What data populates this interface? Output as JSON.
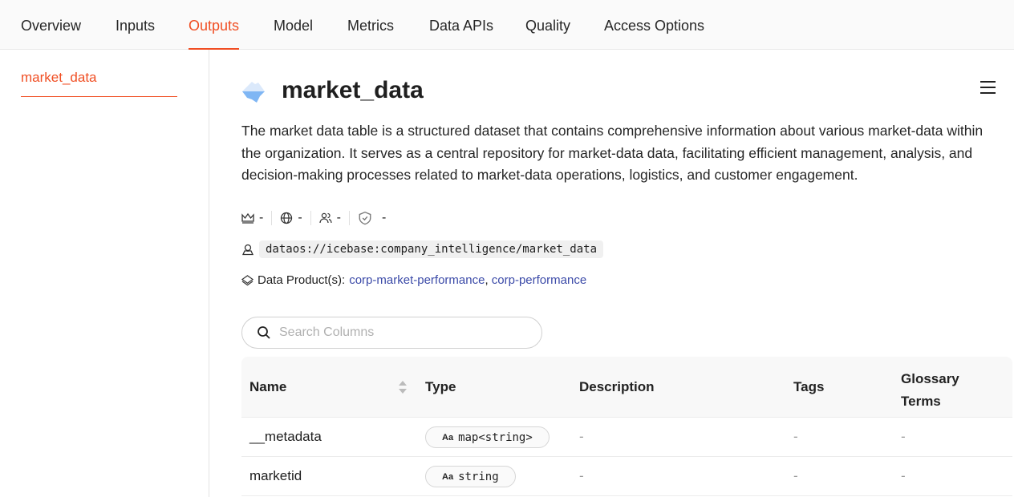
{
  "tabs": [
    "Overview",
    "Inputs",
    "Outputs",
    "Model",
    "Metrics",
    "Data APIs",
    "Quality",
    "Access Options"
  ],
  "active_tab": "Outputs",
  "sidebar": {
    "items": [
      {
        "label": "market_data"
      }
    ]
  },
  "dataset": {
    "title": "market_data",
    "description": "The market data table is a structured dataset that contains comprehensive information about various market-data within the organization. It serves as a central repository for market-data data, facilitating efficient management, analysis, and decision-making processes related to market-data operations, logistics, and customer engagement.",
    "meta": {
      "owner": "-",
      "domain": "-",
      "users": "-",
      "policy": "-"
    },
    "address": "dataos://icebase:company_intelligence/market_data",
    "data_products_label": "Data Product(s):",
    "data_products": [
      "corp-market-performance",
      "corp-performance"
    ],
    "data_products_sep": ","
  },
  "search": {
    "placeholder": "Search Columns",
    "value": ""
  },
  "table": {
    "headers": [
      "Name",
      "Type",
      "Description",
      "Tags",
      "Glossary Terms"
    ],
    "type_icon": "Aa",
    "rows": [
      {
        "name": "__metadata",
        "type": "map<string>",
        "description": "-",
        "tags": "-",
        "glossary": "-"
      },
      {
        "name": "marketid",
        "type": "string",
        "description": "-",
        "tags": "-",
        "glossary": "-"
      }
    ]
  },
  "colors": {
    "accent": "#f04e23",
    "link": "#3b4aa8"
  }
}
